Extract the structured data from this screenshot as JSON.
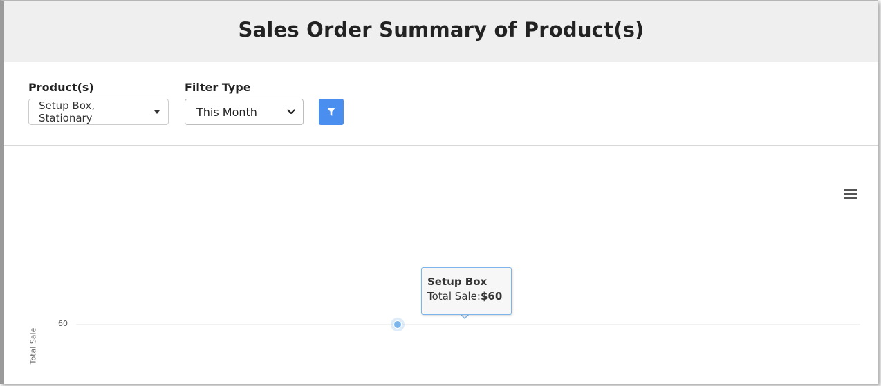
{
  "header": {
    "title": "Sales Order Summary of Product(s)"
  },
  "filters": {
    "products": {
      "label": "Product(s)",
      "value": "Setup Box, Stationary"
    },
    "filter_type": {
      "label": "Filter Type",
      "value": "This Month"
    },
    "apply_icon": "filter-icon",
    "apply_color": "#4a8ff0"
  },
  "chart": {
    "menu_icon": "hamburger-menu-icon",
    "tooltip": {
      "title": "Setup Box",
      "label": "Total Sale:",
      "value": "$60"
    }
  },
  "chart_data": {
    "type": "line",
    "categories": [
      "Setup Box"
    ],
    "series": [
      {
        "name": "Total Sale",
        "values": [
          60
        ],
        "color": "#7cb5ec"
      }
    ],
    "ylabel": "Total Sale",
    "yticks": [
      "60"
    ],
    "grid": true
  }
}
